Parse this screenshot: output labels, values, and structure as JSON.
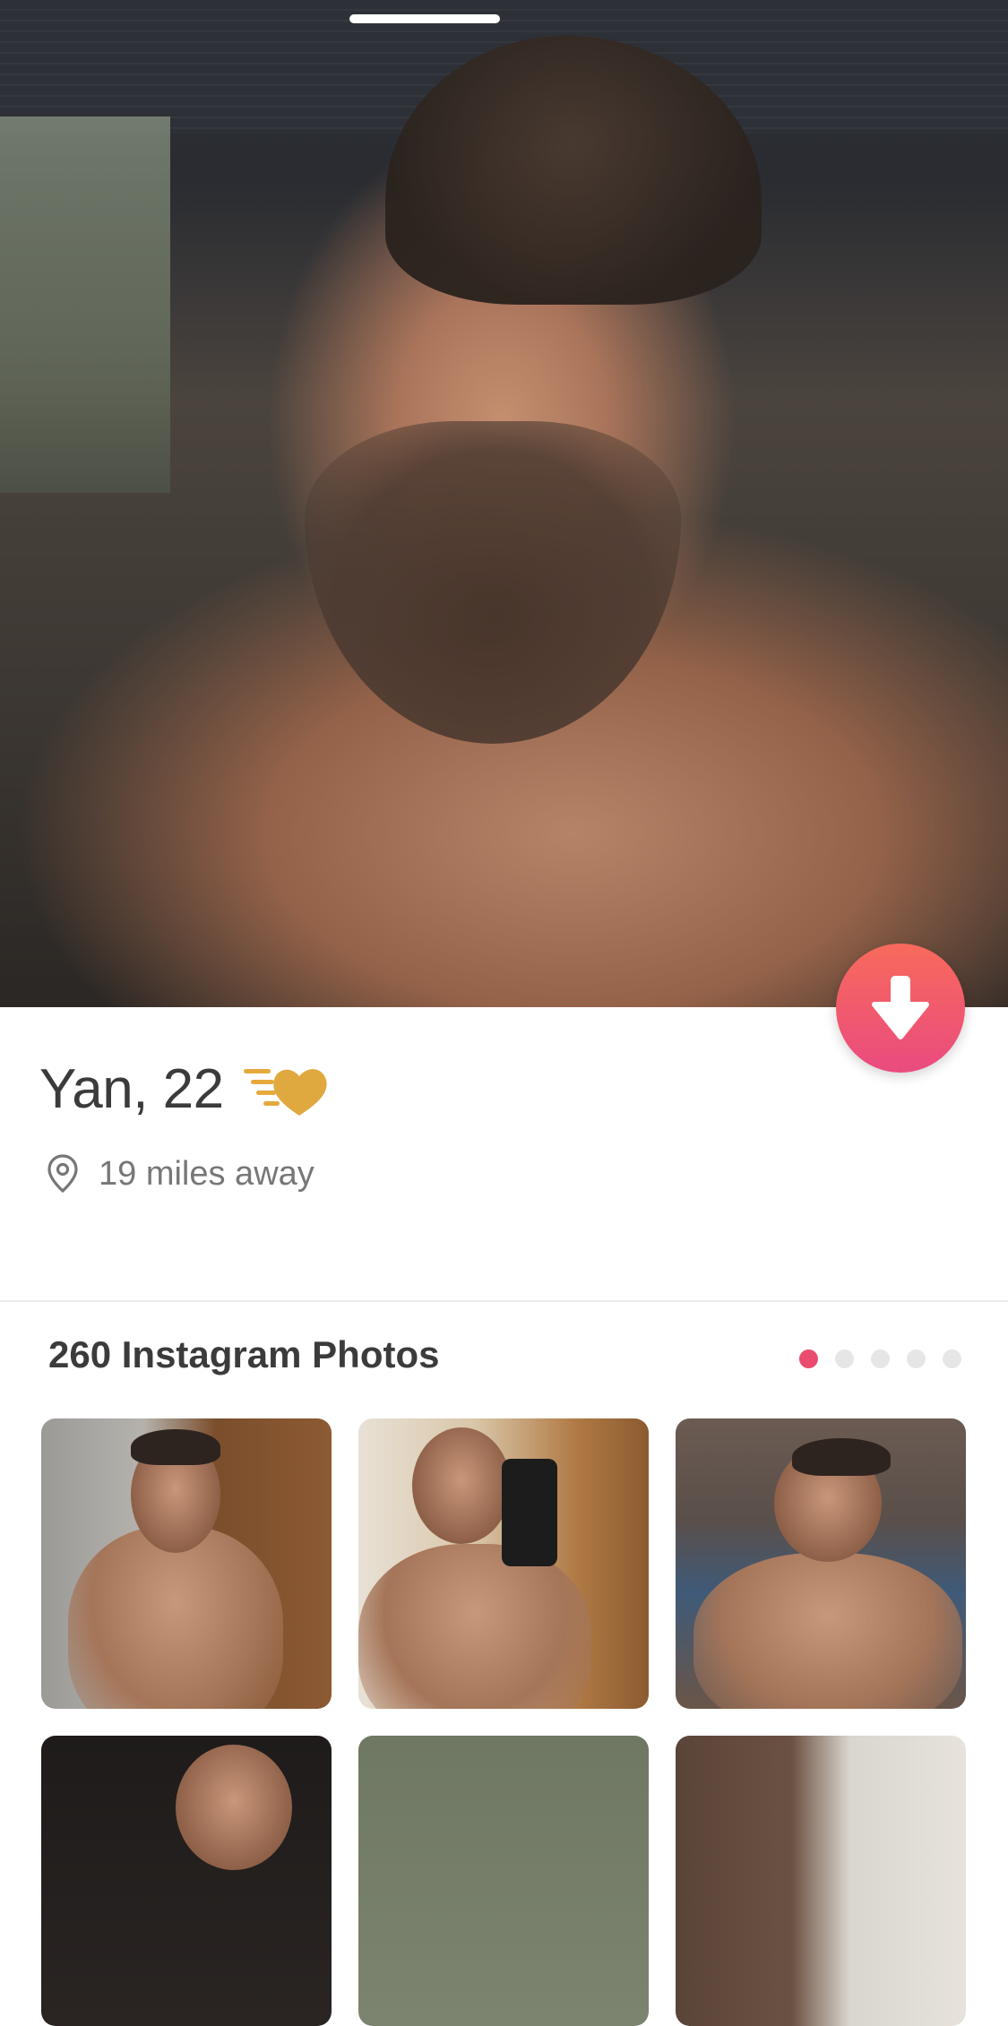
{
  "profile": {
    "name_age": "Yan, 22",
    "distance": "19 miles away",
    "badge_icon": "boost-heart-icon",
    "location_icon": "location-pin-icon"
  },
  "actions": {
    "collapse_icon": "arrow-down-icon",
    "collapse_gradient": [
      "#f86a5b",
      "#ea4b7f"
    ]
  },
  "instagram": {
    "title": "260 Instagram Photos",
    "pager": {
      "pages": 5,
      "active_page": 1
    },
    "photos": [
      "instagram-photo-1",
      "instagram-photo-2",
      "instagram-photo-3",
      "instagram-photo-4",
      "instagram-photo-5",
      "instagram-photo-6"
    ]
  },
  "colors": {
    "accent": "#ea4b6f",
    "gold": "#e5a93c",
    "text_primary": "#3b3b3b",
    "text_secondary": "#777777"
  }
}
